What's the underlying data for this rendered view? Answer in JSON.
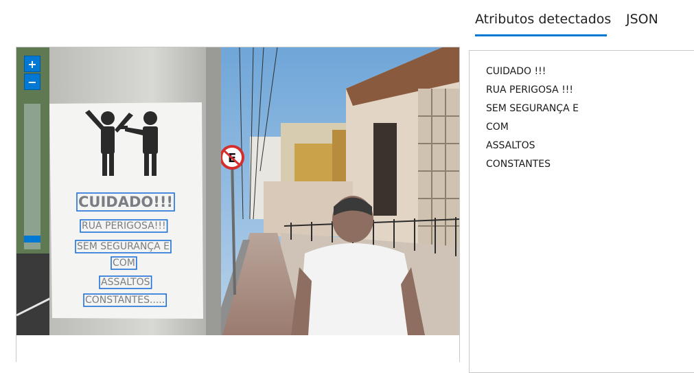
{
  "tabs": [
    {
      "label": "Atributos detectados",
      "active": true
    },
    {
      "label": "JSON",
      "active": false
    }
  ],
  "viewer": {
    "zoom_in_label": "+",
    "zoom_out_label": "−",
    "zoom_level_fraction": 0.0
  },
  "poster": {
    "lines": [
      "CUIDADO!!!",
      "RUA PERIGOSA!!!",
      "SEM SEGURANÇA E",
      "COM",
      "ASSALTOS",
      "CONSTANTES....."
    ]
  },
  "results": {
    "lines": [
      "CUIDADO !!!",
      "RUA PERIGOSA !!!",
      "SEM SEGURANÇA E",
      "COM",
      "ASSALTOS",
      "CONSTANTES"
    ]
  },
  "colors": {
    "accent": "#0078d4",
    "detection_box": "#1e6fd9"
  }
}
